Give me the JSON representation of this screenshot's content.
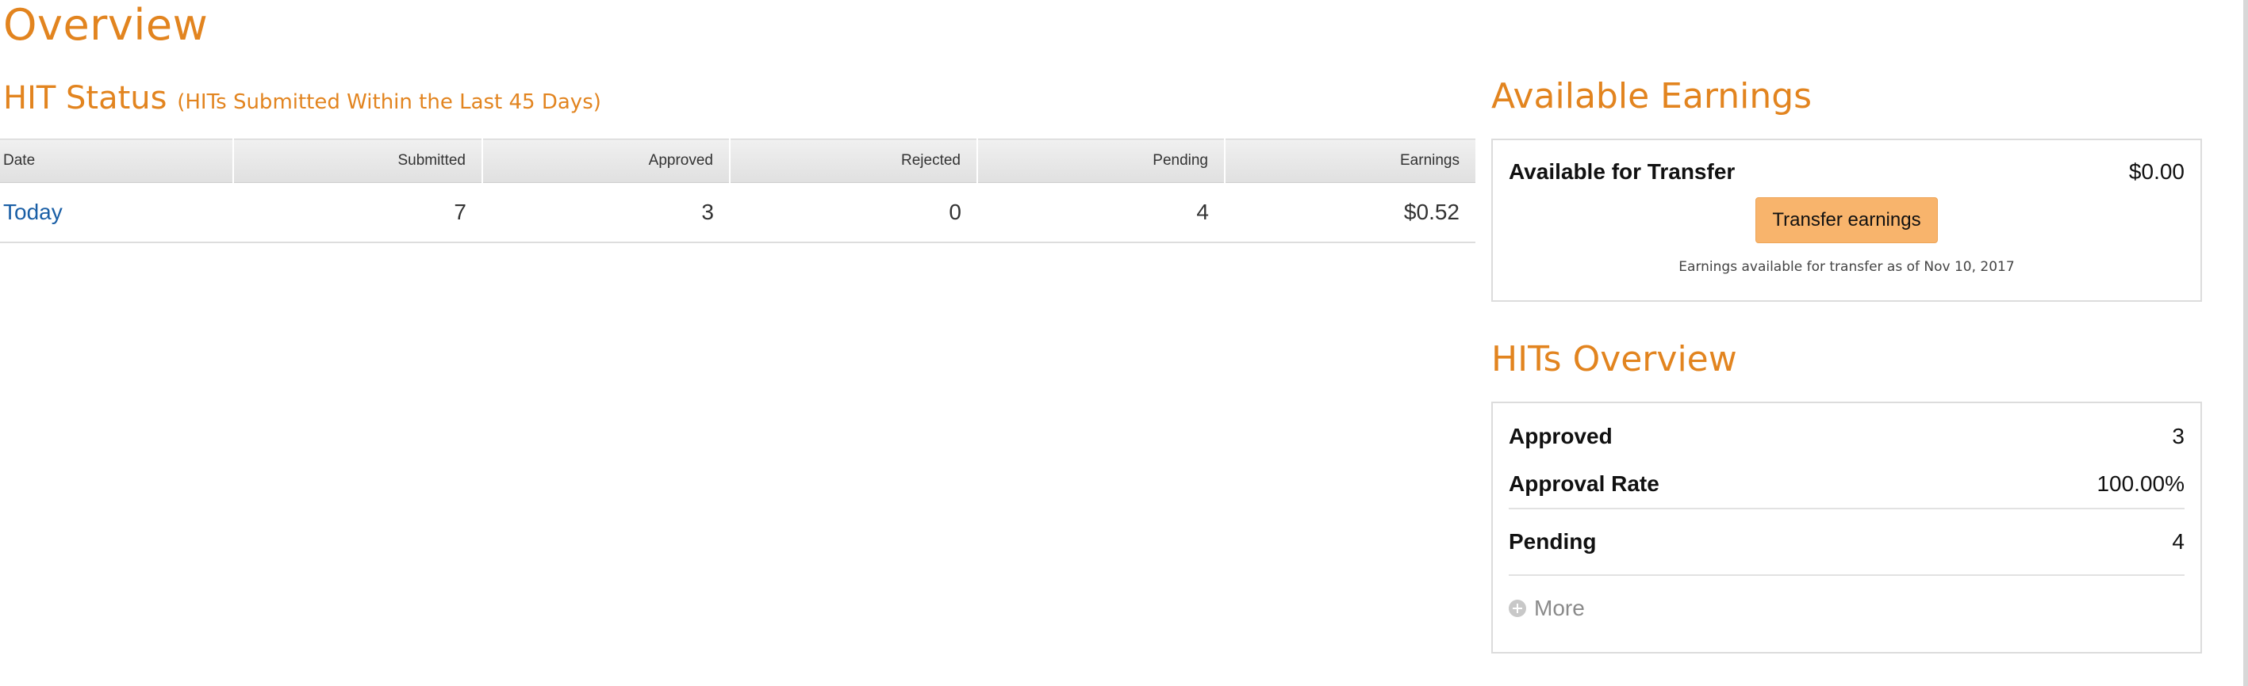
{
  "page": {
    "title": "Overview"
  },
  "hit_status": {
    "title": "HIT Status",
    "subtitle": "(HITs Submitted Within the Last 45 Days)",
    "columns": [
      "Date",
      "Submitted",
      "Approved",
      "Rejected",
      "Pending",
      "Earnings"
    ],
    "rows": [
      {
        "date": "Today",
        "submitted": "7",
        "approved": "3",
        "rejected": "0",
        "pending": "4",
        "earnings": "$0.52"
      }
    ]
  },
  "available_earnings": {
    "title": "Available Earnings",
    "transfer_label": "Available for Transfer",
    "transfer_value": "$0.00",
    "button_label": "Transfer earnings",
    "note": "Earnings available for transfer as of Nov 10, 2017"
  },
  "hits_overview": {
    "title": "HITs Overview",
    "approved_label": "Approved",
    "approved_value": "3",
    "approval_rate_label": "Approval Rate",
    "approval_rate_value": "100.00%",
    "pending_label": "Pending",
    "pending_value": "4",
    "more_label": "More",
    "more_icon": "plus-circle-icon"
  },
  "colors": {
    "heading_orange": "#e2841f",
    "button_orange": "#f8b46c",
    "link_blue": "#1a5fa6"
  }
}
